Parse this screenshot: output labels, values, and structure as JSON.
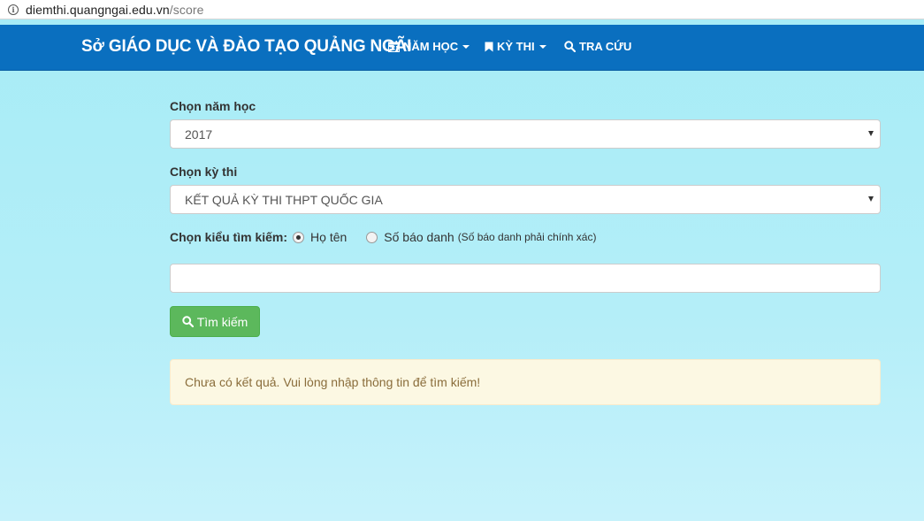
{
  "browser": {
    "url_host": "diemthi.quangngai.edu.vn",
    "url_path": "/score"
  },
  "navbar": {
    "brand": "Sở GIÁO DỤC VÀ ĐÀO TẠO QUẢNG NGÃI",
    "items": [
      {
        "label": "NĂM HỌC",
        "icon": "calendar-icon"
      },
      {
        "label": "KỲ THI",
        "icon": "bookmark-icon"
      },
      {
        "label": "TRA CỨU",
        "icon": "search-icon"
      }
    ]
  },
  "form": {
    "year_label": "Chọn năm học",
    "year_value": "2017",
    "exam_label": "Chọn kỳ thi",
    "exam_value": "KẾT QUẢ KỲ THI THPT QUỐC GIA",
    "search_type_label": "Chọn kiểu tìm kiếm:",
    "search_type_options": [
      {
        "label": "Họ tên",
        "checked": true
      },
      {
        "label": "Số báo danh",
        "checked": false
      }
    ],
    "search_type_note": "(Số báo danh phải chính xác)",
    "query_value": "",
    "submit_label": "Tìm kiếm"
  },
  "alert": {
    "message": "Chưa có kết quả. Vui lòng nhập thông tin để tìm kiếm!"
  },
  "colors": {
    "navbar": "#0a6fbf",
    "button": "#5cb85c",
    "alert_bg": "#fcf8e3",
    "alert_text": "#8a6d3b",
    "background": "#a6ecf6"
  }
}
